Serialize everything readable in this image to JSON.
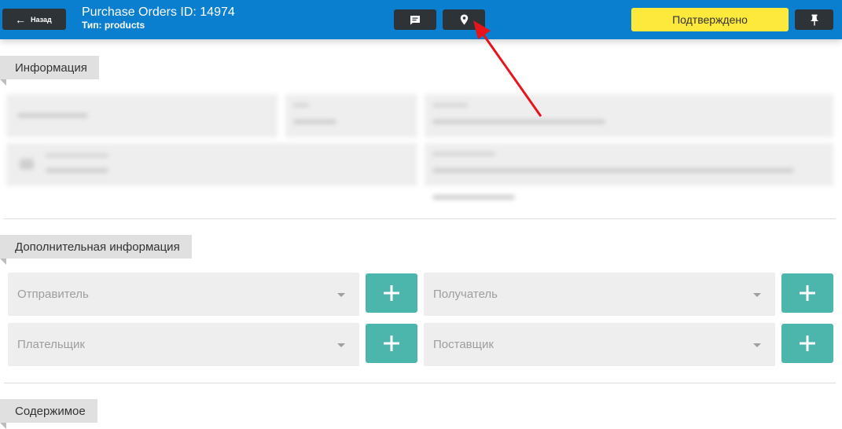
{
  "header": {
    "back_label": "Назад",
    "title": "Purchase Orders ID: 14974",
    "subtitle": "Тип: products",
    "status_label": "Подтверждено",
    "status_color": "#fce93b",
    "bar_color": "#0a7fd0",
    "icons": [
      "arrow-left-icon",
      "comment-icon",
      "map-pin-icon",
      "pin-icon"
    ]
  },
  "sections": {
    "info": "Информация",
    "additional": "Дополнительная информация",
    "contents": "Содержимое"
  },
  "fields": {
    "sender": "Отправитель",
    "recipient": "Получатель",
    "payer": "Плательщик",
    "supplier": "Поставщик"
  },
  "annotation": {
    "type": "red-arrow",
    "color": "#e8141c",
    "points_to": "map-pin-icon"
  }
}
